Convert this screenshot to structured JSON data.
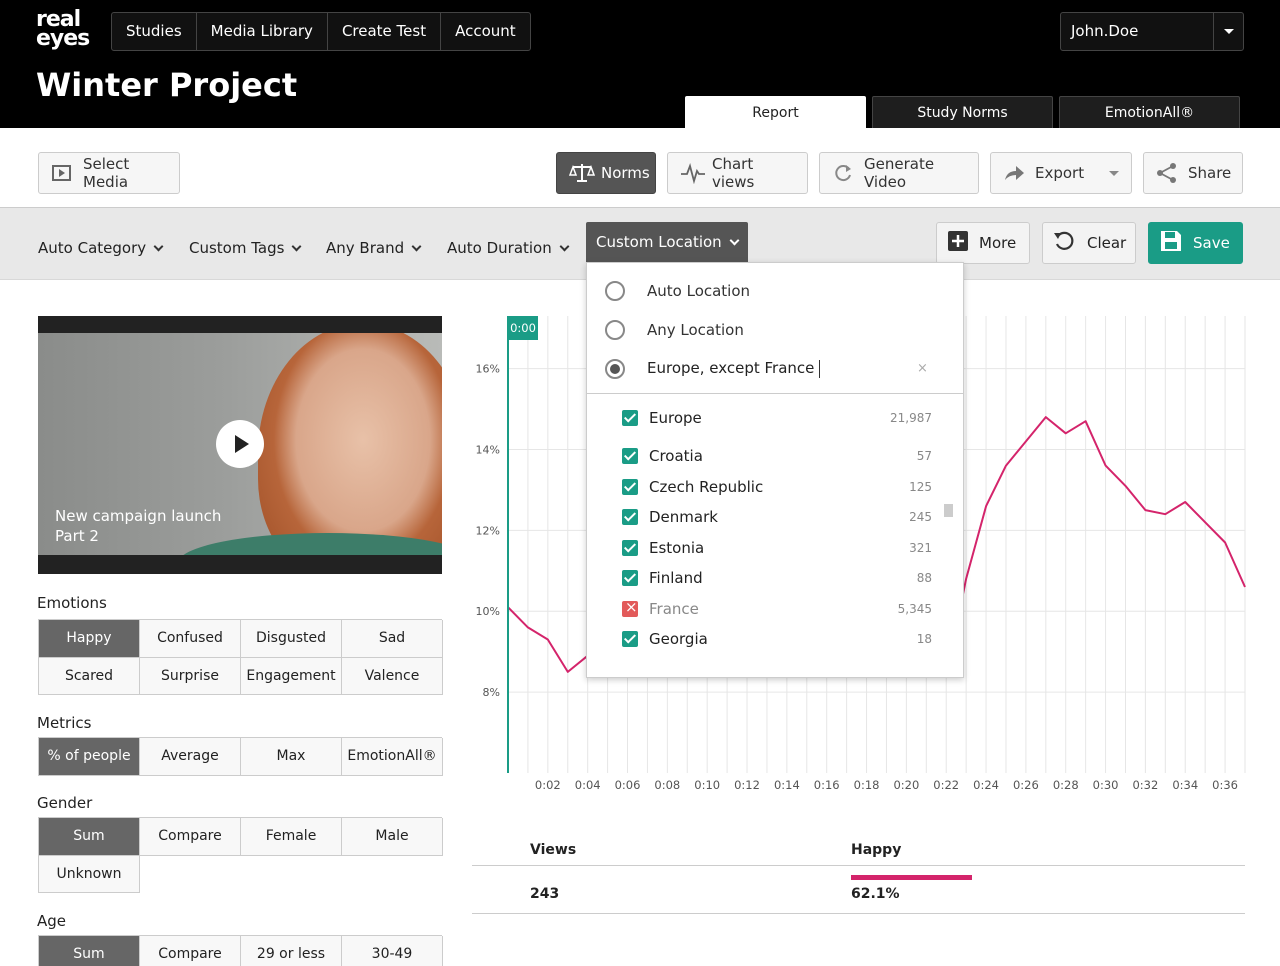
{
  "header": {
    "logo_line1": "real",
    "logo_line2": "eyes",
    "nav": [
      "Studies",
      "Media Library",
      "Create Test",
      "Account"
    ],
    "user": "John.Doe",
    "project_title": "Winter Project",
    "tabs": [
      "Report",
      "Study Norms",
      "EmotionAll®"
    ],
    "active_tab": "Report"
  },
  "toolbar": {
    "select_media": "Select Media",
    "norms": "Norms",
    "chart_views": "Chart views",
    "generate_video": "Generate Video",
    "export": "Export",
    "share": "Share"
  },
  "filters": {
    "items": [
      "Auto Category",
      "Custom Tags",
      "Any Brand",
      "Auto Duration",
      "Custom Location"
    ],
    "active": "Custom Location",
    "more": "More",
    "clear": "Clear",
    "save": "Save"
  },
  "video": {
    "caption_line1": "New campaign launch",
    "caption_line2": "Part 2"
  },
  "emotions": {
    "label": "Emotions",
    "options": [
      "Happy",
      "Confused",
      "Disgusted",
      "Sad",
      "Scared",
      "Surprise",
      "Engagement",
      "Valence"
    ],
    "selected": "Happy"
  },
  "metrics": {
    "label": "Metrics",
    "options": [
      "% of people",
      "Average",
      "Max",
      "EmotionAll®"
    ],
    "selected": "% of people"
  },
  "gender": {
    "label": "Gender",
    "options": [
      "Sum",
      "Compare",
      "Female",
      "Male",
      "Unknown"
    ],
    "selected": "Sum"
  },
  "age": {
    "label": "Age",
    "options": [
      "Sum",
      "Compare",
      "29 or less",
      "30-49"
    ],
    "selected": "Sum"
  },
  "location_dropdown": {
    "radio_options": [
      "Auto Location",
      "Any Location"
    ],
    "custom_value": "Europe, except France",
    "clear_icon": "×",
    "countries": [
      {
        "name": "Europe",
        "count": "21,987",
        "state": "checked"
      },
      {
        "name": "Croatia",
        "count": "57",
        "state": "checked"
      },
      {
        "name": "Czech Republic",
        "count": "125",
        "state": "checked"
      },
      {
        "name": "Denmark",
        "count": "245",
        "state": "checked"
      },
      {
        "name": "Estonia",
        "count": "321",
        "state": "checked"
      },
      {
        "name": "Finland",
        "count": "88",
        "state": "checked"
      },
      {
        "name": "France",
        "count": "5,345",
        "state": "excluded"
      },
      {
        "name": "Georgia",
        "count": "18",
        "state": "checked"
      }
    ]
  },
  "chart_data": {
    "type": "line",
    "playhead_label": "0:00",
    "y_ticks": [
      "16%",
      "14%",
      "12%",
      "10%",
      "8%"
    ],
    "y_values": [
      16,
      14,
      12,
      10,
      8
    ],
    "ylim": [
      6.0,
      17.3
    ],
    "x_ticks": [
      "0:02",
      "0:04",
      "0:06",
      "0:08",
      "0:10",
      "0:12",
      "0:14",
      "0:16",
      "0:18",
      "0:20",
      "0:22",
      "0:24",
      "0:26",
      "0:28",
      "0:30",
      "0:32",
      "0:34",
      "0:36"
    ],
    "xlim": [
      0,
      37
    ],
    "series": [
      {
        "color": "#d4246b",
        "points": [
          [
            0,
            10.1
          ],
          [
            1,
            9.6
          ],
          [
            2,
            9.3
          ],
          [
            3,
            8.5
          ],
          [
            4,
            8.9
          ],
          [
            22.5,
            9.6
          ],
          [
            23,
            10.8
          ],
          [
            24,
            12.6
          ],
          [
            25,
            13.6
          ],
          [
            26,
            14.2
          ],
          [
            27,
            14.8
          ],
          [
            28,
            14.4
          ],
          [
            29,
            14.7
          ],
          [
            30,
            13.6
          ],
          [
            31,
            13.1
          ],
          [
            32,
            12.5
          ],
          [
            33,
            12.4
          ],
          [
            34,
            12.7
          ],
          [
            35,
            12.2
          ],
          [
            36,
            11.7
          ],
          [
            37,
            10.6
          ]
        ]
      }
    ],
    "grid": true
  },
  "summary": {
    "headers": [
      "Views",
      "Happy"
    ],
    "views": "243",
    "happy": "62.1%",
    "happy_fraction": 0.621,
    "bar_color": "#d4246b"
  }
}
